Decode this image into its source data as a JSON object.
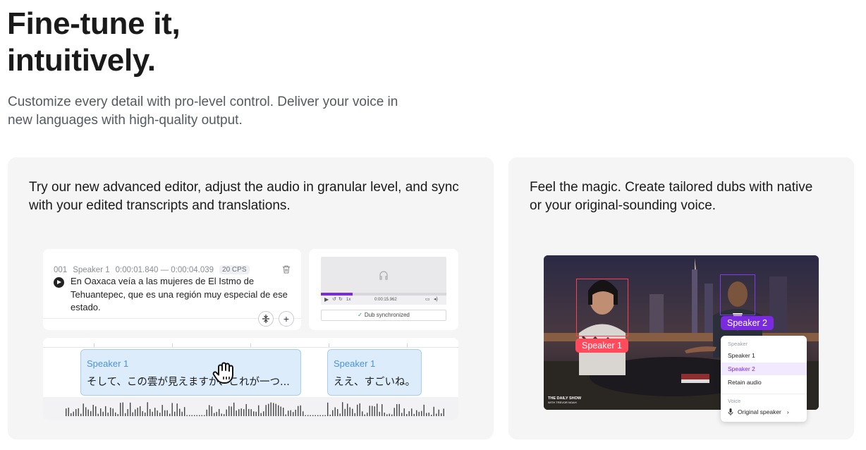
{
  "hero": {
    "title_line1": "Fine-tune it,",
    "title_line2": "intuitively.",
    "subtitle": "Customize every detail with pro-level control. Deliver your voice in new languages with high-quality output."
  },
  "card_left": {
    "title": "Try our new advanced editor, adjust the audio in granular level, and sync with your edited transcripts and translations.",
    "transcript": {
      "index": "001",
      "speaker": "Speaker 1",
      "time_range": "0:00:01.840 — 0:00:04.039",
      "cps": "20 CPS",
      "text": "En Oaxaca veía a las mujeres de El Istmo de Tehuantepec, que es una región muy especial de ese estado."
    },
    "player": {
      "progress": 0.25,
      "time_label": "0:00:15.962",
      "speed": "1x",
      "sync_status": "Dub synchronized"
    },
    "timeline": {
      "segments": [
        {
          "speaker": "Speaker 1",
          "text": "そして、この雲が見えますが、これが一つ..."
        },
        {
          "speaker": "Speaker 1",
          "text": "ええ、すごいね。"
        }
      ]
    }
  },
  "card_right": {
    "title": "Feel the magic. Create tailored dubs with native or your original-sounding voice.",
    "tags": {
      "speaker1": "Speaker 1",
      "speaker2": "Speaker 2"
    },
    "show_logo_line1": "THE DAILY SHOW",
    "show_logo_line2": "WITH TREVOR NOAH",
    "dropdown": {
      "speaker_section": "Speaker",
      "items": [
        "Speaker 1",
        "Speaker 2",
        "Retain audio"
      ],
      "selected": "Speaker 2",
      "voice_section": "Voice",
      "voice_value": "Original speaker"
    }
  },
  "colors": {
    "accent_purple": "#7a2be0",
    "speaker1_red": "#ff4b5c",
    "segment_blue": "#4a94d9"
  }
}
